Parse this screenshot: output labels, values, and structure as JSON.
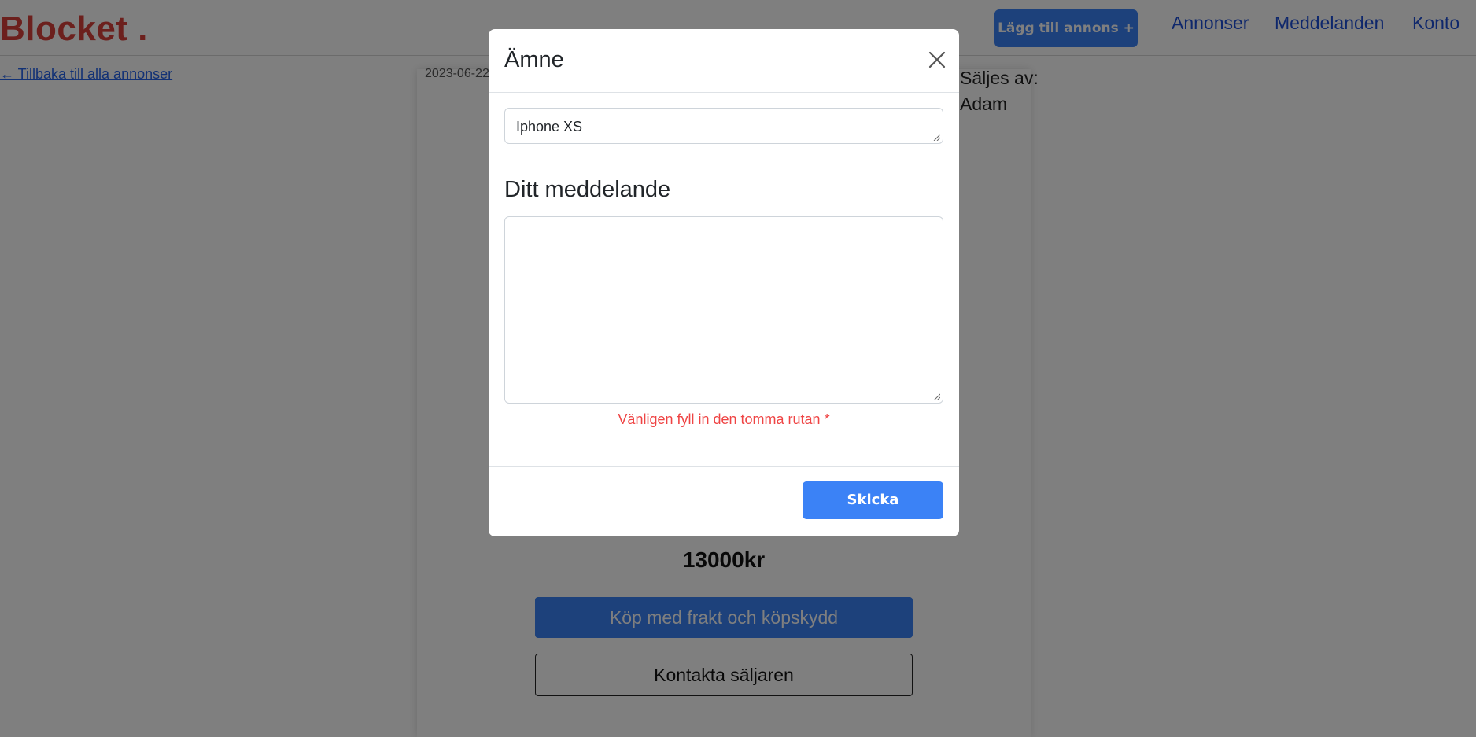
{
  "header": {
    "logo": "Blocket .",
    "add_ad_label": "Lägg till annons +",
    "nav": {
      "ads": "Annonser",
      "messages": "Meddelanden",
      "account": "Konto"
    }
  },
  "back_link": "← Tillbaka till alla annonser",
  "listing": {
    "date": "2023-06-22",
    "seller_label": "Säljes av:",
    "seller_name": "Adam",
    "price": "13000kr",
    "buy_label": "Köp med frakt och köpskydd",
    "contact_label": "Kontakta säljaren"
  },
  "modal": {
    "title": "Ämne",
    "subject_value": "Iphone XS",
    "message_heading": "Ditt meddelande",
    "message_value": "",
    "error": "Vänligen fyll in den tomma rutan *",
    "send_label": "Skicka"
  },
  "colors": {
    "brand": "#d9413a",
    "primary": "#3b82f6",
    "link": "#1d4ed8",
    "error": "#ef4444"
  }
}
